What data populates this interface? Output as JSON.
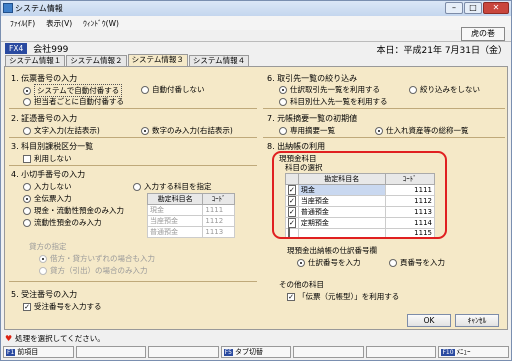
{
  "window": {
    "title": "システム情報"
  },
  "menu": [
    "ﾌｧｲﾙ(F)",
    "表示(V)",
    "ｳｨﾝﾄﾞｳ(W)"
  ],
  "toolbar": {
    "tora_label": "虎の巻"
  },
  "company": {
    "code": "FX4",
    "name": "会社999",
    "date": "本日：平成21年 7月31日（金）"
  },
  "tabs": [
    "システム情報１",
    "システム情報２",
    "システム情報３",
    "システム情報４"
  ],
  "s1": {
    "title": "1. 伝票番号の入力",
    "opt1": "システムで自動付番する",
    "opt2": "自動付番しない",
    "opt3": "担当者ごとに自動付番する"
  },
  "s2": {
    "title": "2. 証憑番号の入力",
    "opt1": "文字入力(左詰表示)",
    "opt2": "数字のみ入力(右詰表示)"
  },
  "s3": {
    "title": "3. 科目別課税区分一覧",
    "opt1": "利用しない"
  },
  "s4": {
    "title": "4. 小切手番号の入力",
    "opt1": "入力しない",
    "opt2": "入力する科目を指定",
    "opt3": "全伝票入力",
    "opt4": "現金・流動性預金のみ入力",
    "opt5": "流動性預金のみ入力",
    "th1": "勘定科目名",
    "th2": "ｺｰﾄﾞ",
    "rows": [
      [
        "現金",
        "1111"
      ],
      [
        "当座預金",
        "1112"
      ],
      [
        "普通預金",
        "1113"
      ]
    ],
    "kashikata": "貸方の指定",
    "k1": "借方・貸方いずれの場合も入力",
    "k2": "貸方（引出）の場合のみ入力"
  },
  "s5": {
    "title": "5. 受注番号の入力",
    "opt1": "受注番号を入力する"
  },
  "s6": {
    "title": "6. 取引先一覧の絞り込み",
    "opt1": "仕訳取引先一覧を利用する",
    "opt2": "絞り込みをしない",
    "opt3": "科目別仕入先一覧を利用する"
  },
  "s7": {
    "title": "7. 元帳摘要一覧の初期値",
    "opt1": "専用摘要一覧",
    "opt2": "仕入れ資産等の総称一覧"
  },
  "s8": {
    "title": "8. 出納帳の利用",
    "sub": "現預金科目",
    "sub2": "科目の選択",
    "th1": "勘定科目名",
    "th2": "ｺｰﾄﾞ",
    "rows": [
      [
        "現金",
        "1111"
      ],
      [
        "当座預金",
        "1112"
      ],
      [
        "普通預金",
        "1113"
      ],
      [
        "定期預金",
        "1114"
      ],
      [
        "",
        "1115"
      ]
    ],
    "sub3": "現預金出納帳の仕訳番号欄",
    "r1": "仕訳番号を入力",
    "r2": "頁番号を入力",
    "other": "その他の科目",
    "otheropt": "「伝票（元帳型）」を利用する"
  },
  "buttons": {
    "ok": "OK",
    "cancel": "ｷｬﾝｾﾙ"
  },
  "status": "処理を選択してください。",
  "fkeys": [
    {
      "n": "F1",
      "l": "前項目"
    },
    {
      "n": "",
      "l": ""
    },
    {
      "n": "",
      "l": ""
    },
    {
      "n": "F5",
      "l": "タブ切替"
    },
    {
      "n": "",
      "l": ""
    },
    {
      "n": "",
      "l": ""
    },
    {
      "n": "F10",
      "l": "ﾒﾆｭｰ"
    }
  ]
}
